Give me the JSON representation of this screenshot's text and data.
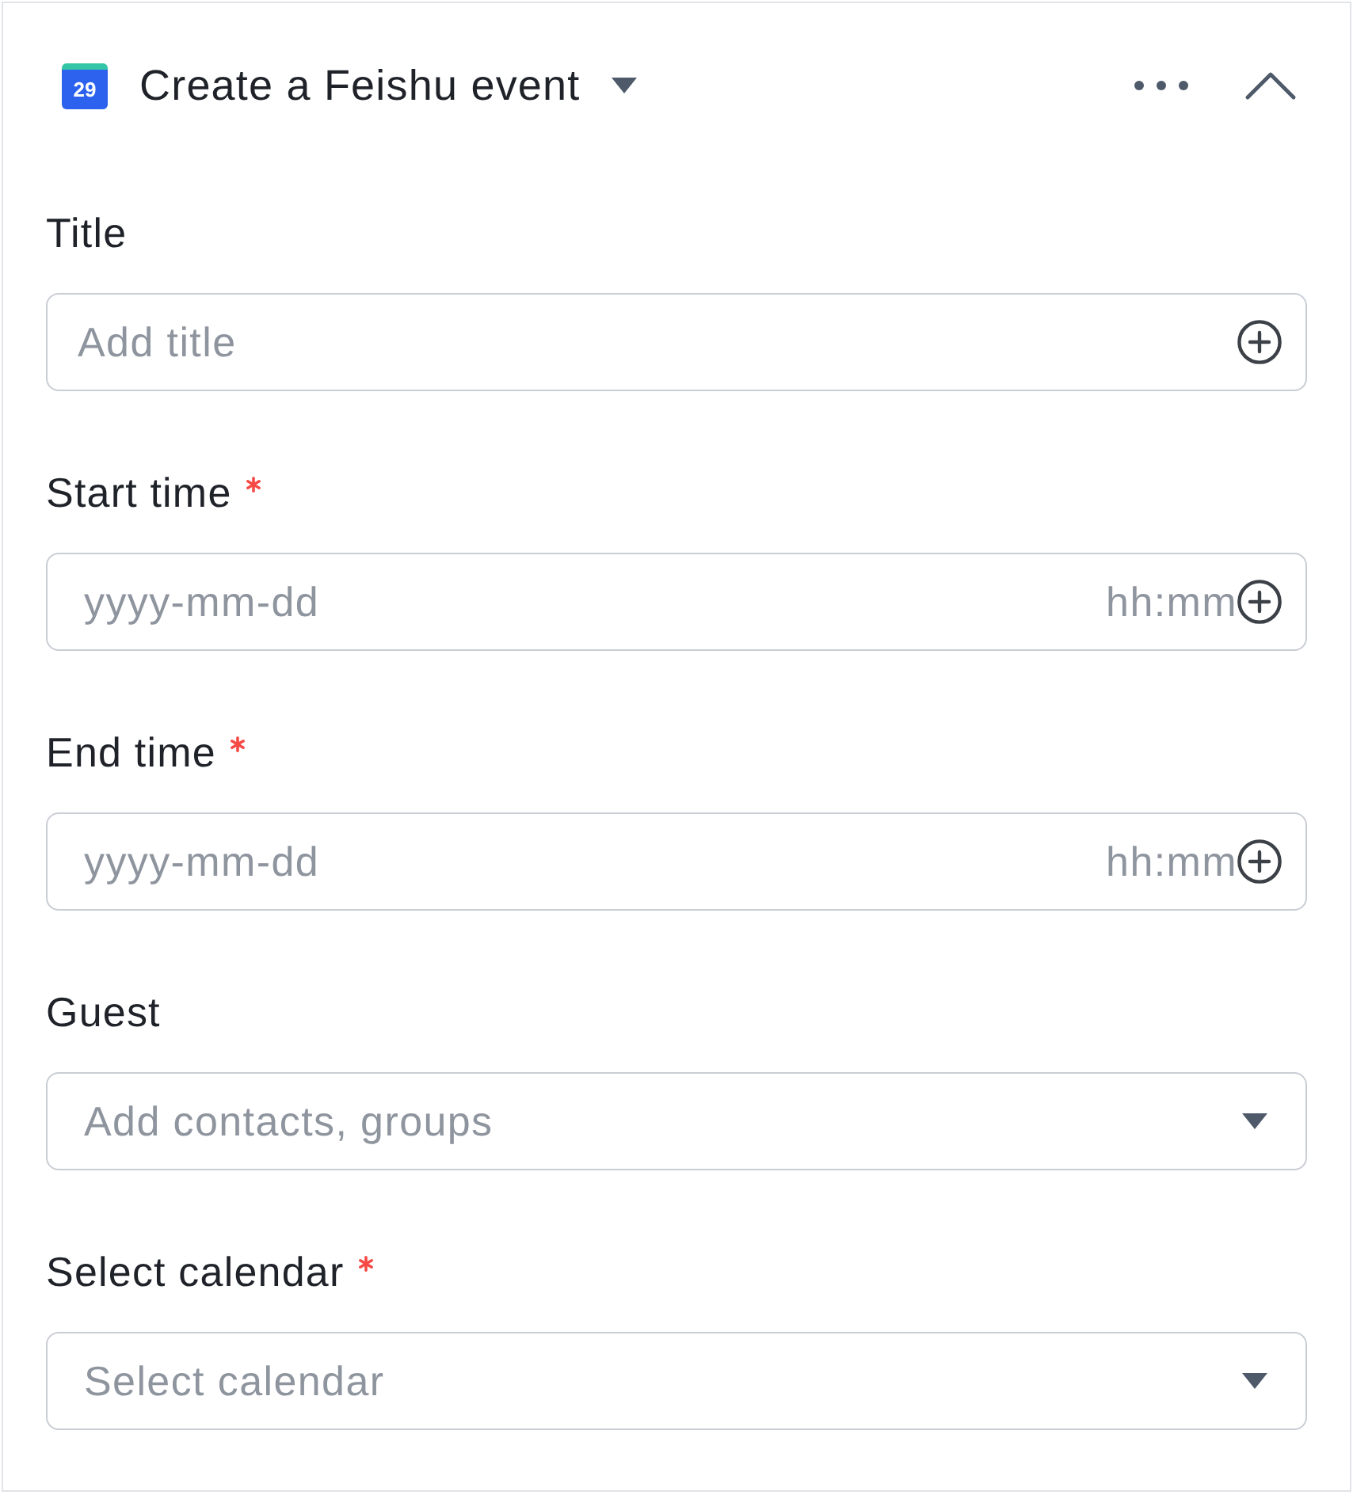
{
  "header": {
    "icon_day": "29",
    "title": "Create a Feishu event"
  },
  "fields": [
    {
      "kind": "text",
      "label": "Title",
      "required": false,
      "placeholder": "Add title"
    },
    {
      "kind": "datetime",
      "label": "Start time",
      "required": true,
      "placeholder": "yyyy-mm-dd",
      "time_placeholder": "hh:mm"
    },
    {
      "kind": "datetime",
      "label": "End time",
      "required": true,
      "placeholder": "yyyy-mm-dd",
      "time_placeholder": "hh:mm"
    },
    {
      "kind": "select",
      "label": "Guest",
      "required": false,
      "placeholder": "Add contacts, groups"
    },
    {
      "kind": "select",
      "label": "Select calendar",
      "required": true,
      "placeholder": "Select calendar"
    }
  ]
}
